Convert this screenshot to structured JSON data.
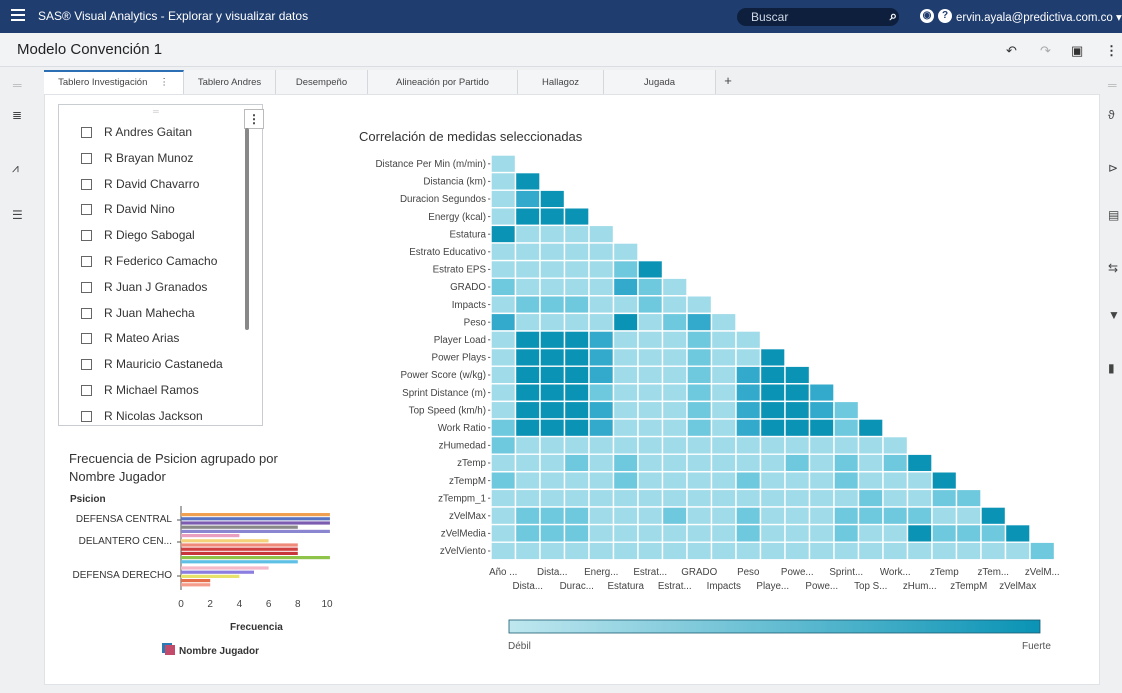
{
  "app": {
    "title": "SAS® Visual Analytics - Explorar y visualizar datos",
    "search_placeholder": "Buscar",
    "user": "ervin.ayala@predictiva.com.co ▾",
    "report_title": "Modelo Convención 1"
  },
  "tabs": [
    {
      "label": "Tablero Investigación",
      "active": true
    },
    {
      "label": "Tablero Andres"
    },
    {
      "label": "Desempeño"
    },
    {
      "label": "Alineación por Partido"
    },
    {
      "label": "Hallagoz"
    },
    {
      "label": "Jugada"
    }
  ],
  "player_list": [
    "R Andres Gaitan",
    "R Brayan Munoz",
    "R David Chavarro",
    "R David Nino",
    "R Diego Sabogal",
    "R Federico Camacho",
    "R Juan J Granados",
    "R Juan Mahecha",
    "R Mateo Arias",
    "R Mauricio Castaneda",
    "R Michael Ramos",
    "R Nicolas Jackson"
  ],
  "bar_panel": {
    "title": "Frecuencia de Psicion agrupado por Nombre Jugador",
    "y_header": "Psicion",
    "legend": "Nombre Jugador"
  },
  "heatmap_panel": {
    "scale_weak": "Débil",
    "scale_strong": "Fuerte"
  },
  "colors": {
    "topbar": "#1f3d6e",
    "heat_low": "#bfe7ef",
    "heat_high": "#0a93b5"
  },
  "chart_data": [
    {
      "type": "bar",
      "orientation": "horizontal",
      "title": "Frecuencia de Psicion agrupado por Nombre Jugador",
      "xlabel": "Frecuencia",
      "ylabel": "Psicion",
      "xlim": [
        0,
        10
      ],
      "xticks": [
        0,
        2,
        4,
        6,
        8,
        10
      ],
      "categories": [
        "DEFENSA CENTRAL",
        "DELANTERO CEN...",
        "DEFENSA DERECHO"
      ],
      "bars": [
        {
          "category": "DEFENSA CENTRAL",
          "value": 10.2,
          "color": "#f0a050"
        },
        {
          "category": "DEFENSA CENTRAL",
          "value": 10.2,
          "color": "#5a74c4"
        },
        {
          "category": "DEFENSA CENTRAL",
          "value": 10.2,
          "color": "#7b5cb0"
        },
        {
          "category": "DEFENSA CENTRAL",
          "value": 8,
          "color": "#888888"
        },
        {
          "category": "DEFENSA CENTRAL",
          "value": 10.2,
          "color": "#8a86d0"
        },
        {
          "category": "DEFENSA CENTRAL",
          "value": 4,
          "color": "#e9a0c0"
        },
        {
          "category": "DELANTERO CEN...",
          "value": 6,
          "color": "#f3d27a"
        },
        {
          "category": "DELANTERO CEN...",
          "value": 8,
          "color": "#ef8a7a"
        },
        {
          "category": "DELANTERO CEN...",
          "value": 8,
          "color": "#d04040"
        },
        {
          "category": "DELANTERO CEN...",
          "value": 8,
          "color": "#c8353a"
        },
        {
          "category": "DELANTERO CEN...",
          "value": 10.2,
          "color": "#8fc44a"
        },
        {
          "category": "DELANTERO CEN...",
          "value": 8,
          "color": "#5fc0e6"
        },
        {
          "category": "DEFENSA DERECHO",
          "value": 6,
          "color": "#f5b8c8"
        },
        {
          "category": "DEFENSA DERECHO",
          "value": 5,
          "color": "#8b7ee0"
        },
        {
          "category": "DEFENSA DERECHO",
          "value": 4,
          "color": "#e7e36a"
        },
        {
          "category": "DEFENSA DERECHO",
          "value": 2,
          "color": "#e46f4a"
        },
        {
          "category": "DEFENSA DERECHO",
          "value": 2,
          "color": "#f59c8a"
        }
      ]
    },
    {
      "type": "heatmap",
      "title": "Correlación de medidas seleccionadas",
      "rows": [
        "Distance Per Min (m/min)",
        "Distancia (km)",
        "Duracion Segundos",
        "Energy (kcal)",
        "Estatura",
        "Estrato Educativo",
        "Estrato EPS",
        "GRADO",
        "Impacts",
        "Peso",
        "Player Load",
        "Power Plays",
        "Power Score (w/kg)",
        "Sprint Distance (m)",
        "Top Speed (km/h)",
        "Work Ratio",
        "zHumedad",
        "zTemp",
        "zTempM",
        "zTempm_1",
        "zVelMax",
        "zVelMedia",
        "zVelViento"
      ],
      "x_labels_row1": [
        "Año ...",
        "Dista...",
        "Energ...",
        "Estrat...",
        "GRADO",
        "Peso",
        "Powe...",
        "Sprint...",
        "Work...",
        "zTemp",
        "zTem...",
        "zVelM..."
      ],
      "x_labels_row2": [
        "Dista...",
        "Durac...",
        "Estatura",
        "Estrat...",
        "Impacts",
        "Playe...",
        "Powe...",
        "Top S...",
        "zHum...",
        "zTempM",
        "zVelMax"
      ],
      "legend": {
        "low": "Débil",
        "high": "Fuerte"
      },
      "values": [
        [
          1
        ],
        [
          1,
          4
        ],
        [
          1,
          3,
          4
        ],
        [
          1,
          4,
          4,
          4
        ],
        [
          4,
          1,
          1,
          1,
          1
        ],
        [
          1,
          1,
          1,
          1,
          1,
          1
        ],
        [
          1,
          1,
          1,
          1,
          1,
          2,
          4
        ],
        [
          2,
          1,
          1,
          1,
          1,
          3,
          2,
          1
        ],
        [
          1,
          2,
          2,
          2,
          1,
          1,
          2,
          1,
          1
        ],
        [
          3,
          1,
          1,
          1,
          1,
          4,
          1,
          2,
          3,
          1
        ],
        [
          1,
          4,
          4,
          4,
          3,
          1,
          1,
          1,
          2,
          1,
          1
        ],
        [
          1,
          4,
          4,
          4,
          3,
          1,
          1,
          1,
          2,
          1,
          1,
          4
        ],
        [
          1,
          4,
          4,
          4,
          3,
          1,
          1,
          1,
          2,
          1,
          3,
          4,
          4
        ],
        [
          1,
          4,
          4,
          4,
          2,
          1,
          1,
          1,
          2,
          1,
          3,
          4,
          4,
          3
        ],
        [
          1,
          4,
          4,
          4,
          3,
          1,
          1,
          1,
          2,
          1,
          3,
          4,
          4,
          3,
          2
        ],
        [
          2,
          4,
          4,
          4,
          3,
          1,
          1,
          1,
          2,
          1,
          3,
          4,
          4,
          4,
          2,
          4
        ],
        [
          2,
          1,
          1,
          1,
          1,
          1,
          1,
          1,
          1,
          1,
          1,
          1,
          1,
          1,
          1,
          1,
          1
        ],
        [
          1,
          1,
          1,
          2,
          1,
          2,
          1,
          1,
          1,
          1,
          1,
          1,
          2,
          1,
          2,
          1,
          2,
          4
        ],
        [
          2,
          1,
          1,
          1,
          1,
          2,
          1,
          1,
          1,
          1,
          2,
          1,
          1,
          1,
          2,
          1,
          1,
          1,
          4
        ],
        [
          1,
          1,
          1,
          1,
          1,
          1,
          1,
          1,
          1,
          1,
          1,
          1,
          1,
          1,
          1,
          2,
          1,
          1,
          2,
          2
        ],
        [
          1,
          2,
          2,
          2,
          1,
          1,
          1,
          2,
          1,
          1,
          2,
          1,
          1,
          1,
          2,
          2,
          2,
          2,
          1,
          1,
          4
        ],
        [
          1,
          2,
          2,
          2,
          1,
          1,
          1,
          1,
          1,
          1,
          2,
          1,
          1,
          1,
          2,
          1,
          1,
          4,
          2,
          2,
          2,
          4
        ],
        [
          1,
          1,
          1,
          1,
          1,
          1,
          1,
          1,
          1,
          1,
          1,
          1,
          1,
          1,
          1,
          1,
          1,
          1,
          1,
          1,
          1,
          1,
          2
        ]
      ]
    }
  ]
}
